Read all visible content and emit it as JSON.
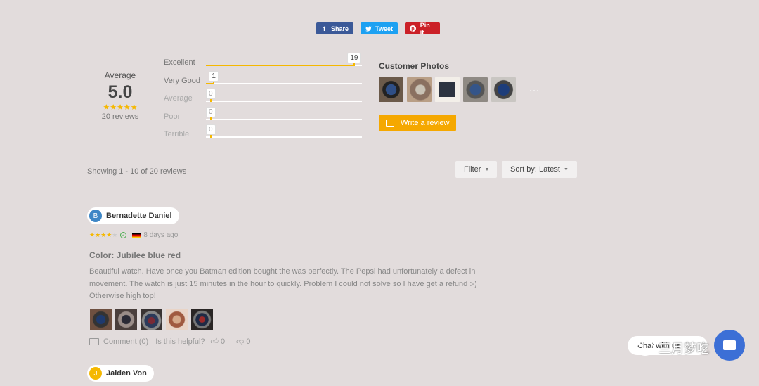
{
  "share": {
    "facebook": "Share",
    "twitter": "Tweet",
    "pinterest": "Pin it"
  },
  "summary": {
    "average_label": "Average",
    "average_score": "5.0",
    "stars": "★★★★★",
    "review_count": "20 reviews",
    "bars": [
      {
        "label": "Excellent",
        "count": "19",
        "fraction": 0.95
      },
      {
        "label": "Very Good",
        "count": "1",
        "fraction": 0.05
      },
      {
        "label": "Average",
        "count": "0",
        "fraction": 0
      },
      {
        "label": "Poor",
        "count": "0",
        "fraction": 0
      },
      {
        "label": "Terrible",
        "count": "0",
        "fraction": 0
      }
    ]
  },
  "customer_photos": {
    "title": "Customer Photos",
    "more": "···",
    "write_review": "Write a review"
  },
  "listing": {
    "showing": "Showing 1 - 10 of 20 reviews",
    "filter": "Filter",
    "sort": "Sort by: Latest"
  },
  "reviews": [
    {
      "initial": "B",
      "name": "Bernadette Daniel",
      "avatar_color": "#3d86c6",
      "stars_on": "★★★★",
      "stars_off": "★",
      "time": "8 days ago",
      "title": "Color: Jubilee blue red",
      "body": "Beautiful watch. Have once you Batman edition bought the was perfectly. The Pepsi had unfortunately a defect in movement. The watch is just 15 minutes in the hour to quickly. Problem I could not solve so I have get a refund :-) Otherwise high top!",
      "comment": "Comment (0)",
      "helpful": "Is this helpful?",
      "likes": "0",
      "dislikes": "0"
    },
    {
      "initial": "J",
      "name": "Jaiden Von",
      "avatar_color": "#f5b800"
    }
  ],
  "chat": {
    "label": "Chat with us"
  },
  "watermark": "三月梦吃"
}
